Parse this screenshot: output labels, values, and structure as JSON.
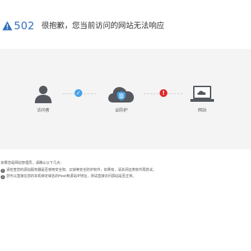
{
  "header": {
    "error_code": "502",
    "title": "很抱歉，您当前访问的网站无法响应"
  },
  "status_flow": {
    "visitor_label": "访问者",
    "cloud_label": "云防护",
    "site_label": "网站",
    "visitor_to_cloud_status": "ok",
    "cloud_to_site_status": "error",
    "ok_symbol": "✓",
    "error_symbol": "!",
    "colors": {
      "icon": "#55595f",
      "ok": "#4aa3e8",
      "error": "#e02828",
      "code": "#2f6fbf"
    }
  },
  "notes": {
    "intro": "如果您是网站管理员，请确认以下几点：",
    "items": [
      {
        "num": "1",
        "text": "请检查您的源站服务器是否使用安全狗、云锁等安全防护软件，如果有，请关闭这类软件再尝试。"
      },
      {
        "num": "2",
        "text": "您可以直接在您的本机绑定域名的Host到源站IP地址，测试直接访问源站是否正常。"
      }
    ]
  }
}
